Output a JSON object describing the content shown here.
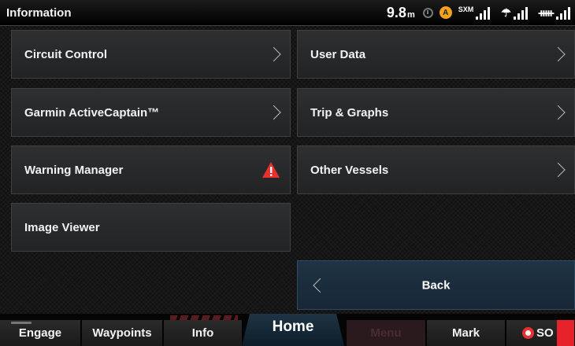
{
  "status": {
    "title": "Information",
    "depth_value": "9.8",
    "depth_unit": "m",
    "nav_badge": "A",
    "sxm_label": "SXM",
    "weather_glyph": "☂",
    "ais_glyph": "ᚔ"
  },
  "menu": {
    "circuit_control": "Circuit Control",
    "user_data": "User Data",
    "activecaptain": "Garmin ActiveCaptain™",
    "trip_graphs": "Trip & Graphs",
    "warning_manager": "Warning Manager",
    "other_vessels": "Other Vessels",
    "image_viewer": "Image Viewer",
    "back": "Back"
  },
  "bottom": {
    "engage": "Engage",
    "waypoints": "Waypoints",
    "info": "Info",
    "home": "Home",
    "menu": "Menu",
    "mark": "Mark",
    "sos": "SO"
  },
  "colors": {
    "warning": "#e8312f",
    "back_button": "#1f3344",
    "menu_tab_inactive": "#2a1a1d",
    "nav_badge": "#f3a21c"
  },
  "icons": [
    "chevron-right-icon",
    "warning-triangle-icon",
    "chevron-left-icon",
    "gps-icon",
    "signal-icon",
    "sos-icon"
  ]
}
